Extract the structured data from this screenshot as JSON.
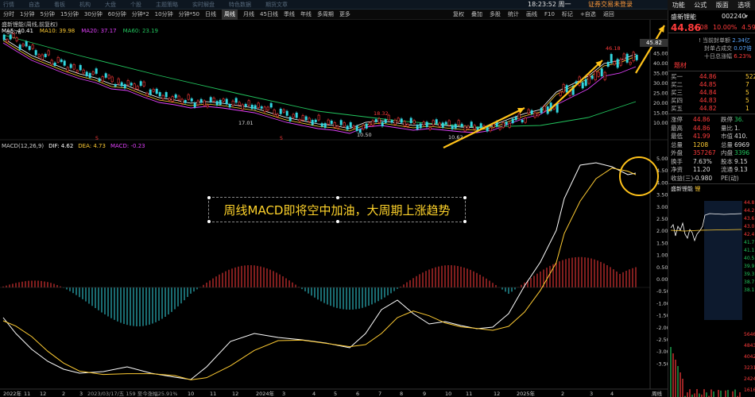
{
  "topbar": {
    "tabs": [
      "行情",
      "自选",
      "看板",
      "机构",
      "大盘",
      "个股",
      "主题策略",
      "实时解盘",
      "特色数据",
      "期货文章"
    ],
    "clock": "18:23:52 周一",
    "login": "证券交易未登录",
    "window_buttons": [
      "—",
      "□",
      "✕",
      "←"
    ]
  },
  "toolbar": {
    "periods": [
      "分时",
      "1分钟",
      "5分钟",
      "15分钟",
      "30分钟",
      "60分钟",
      "分钟*2",
      "10分钟",
      "分钟*50",
      "日线",
      "周线",
      "月线",
      "45日线",
      "季线",
      "年线",
      "多周期",
      "更多"
    ],
    "active_period": "周线",
    "tools": [
      "复权",
      "叠加",
      "多股",
      "统计",
      "画线",
      "F10",
      "标记",
      "+自选",
      "返回"
    ]
  },
  "right_tabs": [
    "功能",
    "公式",
    "版面",
    "选项"
  ],
  "chart": {
    "title": "盛新锂能(周线,前复权)",
    "ma": [
      {
        "label": "MA5: 40.41",
        "color": "#ffffff"
      },
      {
        "label": "MA10: 39.98",
        "color": "#ffcc33"
      },
      {
        "label": "MA20: 37.17",
        "color": "#e040fb"
      },
      {
        "label": "MA60: 23.19",
        "color": "#22c55e"
      }
    ],
    "high_label": "55.76",
    "price_labels": [
      "17.01",
      "18.32",
      "10.50",
      "10.62",
      "46.18"
    ],
    "y_price_box": "45.82",
    "price_axis": [
      "50.00",
      "45.00",
      "40.00",
      "35.00",
      "30.00",
      "25.00",
      "20.00",
      "15.00",
      "10.00"
    ],
    "macd_header": [
      {
        "label": "MACD(12,26,9)",
        "color": "#cccccc"
      },
      {
        "label": "DIF: 4.62",
        "color": "#ffffff"
      },
      {
        "label": "DEA: 4.73",
        "color": "#ffcc33"
      },
      {
        "label": "MACD: -0.23",
        "color": "#e040fb"
      }
    ],
    "macd_axis": [
      "5.00",
      "4.50",
      "4.00",
      "3.50",
      "3.00",
      "2.50",
      "2.00",
      "1.50",
      "1.00",
      "0.50",
      "0.00",
      "-0.50",
      "-1.00",
      "-1.50",
      "-2.00",
      "-2.50",
      "-3.00",
      "-3.50"
    ],
    "x_axis": [
      "2022年",
      "11",
      "12",
      "2",
      "3",
      "2023/03/17/五 159 至今涨幅25.91%",
      "10",
      "11",
      "12",
      "2024年",
      "3",
      "4",
      "5",
      "6",
      "7",
      "8",
      "9",
      "10",
      "11",
      "12",
      "2025年",
      "2",
      "3",
      "4"
    ],
    "x_axis_right": "周线",
    "annotation": "周线MACD即将空中加油，大周期上涨趋势"
  },
  "side": {
    "name": "盛新锂能",
    "code": "002240",
    "price": "44.86",
    "change": "4.08",
    "change_pct": "10.00%",
    "extra_pct": "4.59",
    "tag": "题材",
    "kv": [
      {
        "label": "当前封单额",
        "value": "2.34亿"
      },
      {
        "label": "封单占成交",
        "value": "0.07倍"
      },
      {
        "label": "十日总涨幅",
        "value": "6.23%"
      }
    ],
    "order_book": [
      {
        "label": "买一",
        "price": "44.86",
        "vol": "522"
      },
      {
        "label": "买二",
        "price": "44.85",
        "vol": "7"
      },
      {
        "label": "买三",
        "price": "44.84",
        "vol": "5"
      },
      {
        "label": "买四",
        "price": "44.83",
        "vol": "5"
      },
      {
        "label": "买五",
        "price": "44.82",
        "vol": "1"
      }
    ],
    "stats": [
      {
        "l1": "涨停",
        "v1": "44.86",
        "c1": "red",
        "l2": "跌停",
        "v2": "36.",
        "c2": "green"
      },
      {
        "l1": "最高",
        "v1": "44.86",
        "c1": "red",
        "l2": "量比",
        "v2": "1.",
        "c2": "white"
      },
      {
        "l1": "最低",
        "v1": "41.99",
        "c1": "red",
        "l2": "市值",
        "v2": "410.",
        "c2": "white"
      },
      {
        "l1": "总量",
        "v1": "1208",
        "c1": "yellow",
        "l2": "总量",
        "v2": "6969",
        "c2": "white"
      },
      {
        "l1": "外盘",
        "v1": "357267",
        "c1": "red",
        "l2": "内盘",
        "v2": "3396",
        "c2": "green"
      },
      {
        "l1": "换手",
        "v1": "7.63%",
        "c1": "white",
        "l2": "股本",
        "v2": "9.15",
        "c2": "white"
      },
      {
        "l1": "净资",
        "v1": "11.20",
        "c1": "white",
        "l2": "流通",
        "v2": "9.13",
        "c2": "white"
      },
      {
        "l1": "收益(三)",
        "v1": "-0.980",
        "c1": "white",
        "l2": "PE(动)",
        "v2": "",
        "c2": "white"
      }
    ],
    "mini_title": "盛新锂能",
    "mini_flag": "锂",
    "mini_price_labels": [
      "44.8",
      "44.2",
      "43.6",
      "43.0",
      "42.4",
      "41.7",
      "41.1",
      "40.5",
      "39.9",
      "39.3",
      "38.7",
      "38.1"
    ],
    "mini_vol_labels": [
      "5646",
      "4843",
      "4042",
      "3231",
      "2424",
      "1616",
      "8080"
    ]
  },
  "colors": {
    "up": "#ff3b3b",
    "down": "#33d6e0",
    "arrow": "#ffc21a",
    "circle": "#ffc21a"
  }
}
